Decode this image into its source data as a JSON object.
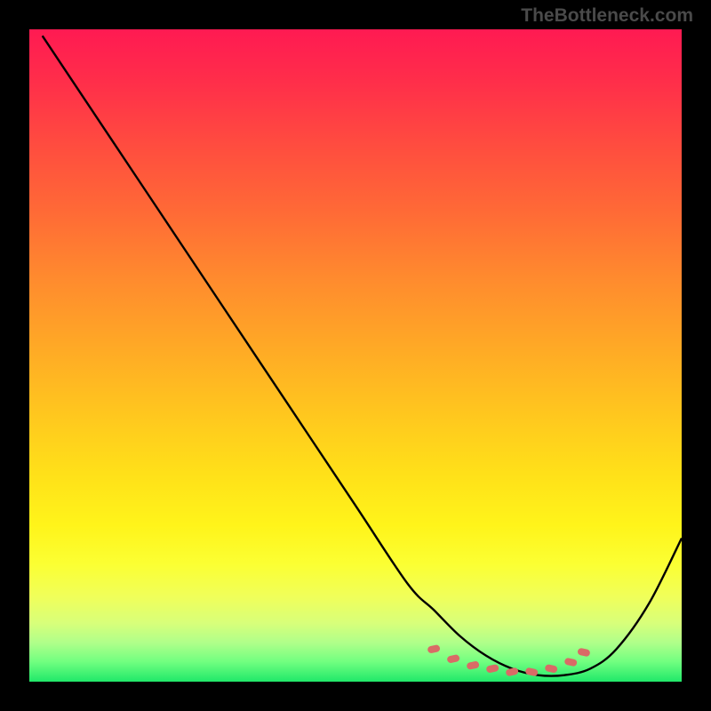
{
  "watermark": "TheBottleneck.com",
  "chart_data": {
    "type": "line",
    "title": "",
    "xlabel": "",
    "ylabel": "",
    "xlim": [
      0,
      100
    ],
    "ylim": [
      0,
      100
    ],
    "series": [
      {
        "name": "bottleneck-curve",
        "x": [
          2,
          10,
          20,
          30,
          40,
          50,
          58,
          62,
          66,
          70,
          74,
          78,
          82,
          86,
          90,
          95,
          100
        ],
        "values": [
          99,
          87,
          72,
          57,
          42,
          27,
          15,
          11,
          7,
          4,
          2,
          1,
          1,
          2,
          5,
          12,
          22
        ]
      }
    ],
    "markers": {
      "comment": "dotted salmon markers near the trough",
      "x": [
        62,
        65,
        68,
        71,
        74,
        77,
        80,
        83,
        85
      ],
      "values": [
        5,
        3.5,
        2.5,
        2,
        1.5,
        1.5,
        2,
        3,
        4.5
      ]
    },
    "colors": {
      "gradient_top": "#ff1a52",
      "gradient_bottom": "#20e86a",
      "curve": "#000000",
      "marker": "#d96b66"
    }
  }
}
